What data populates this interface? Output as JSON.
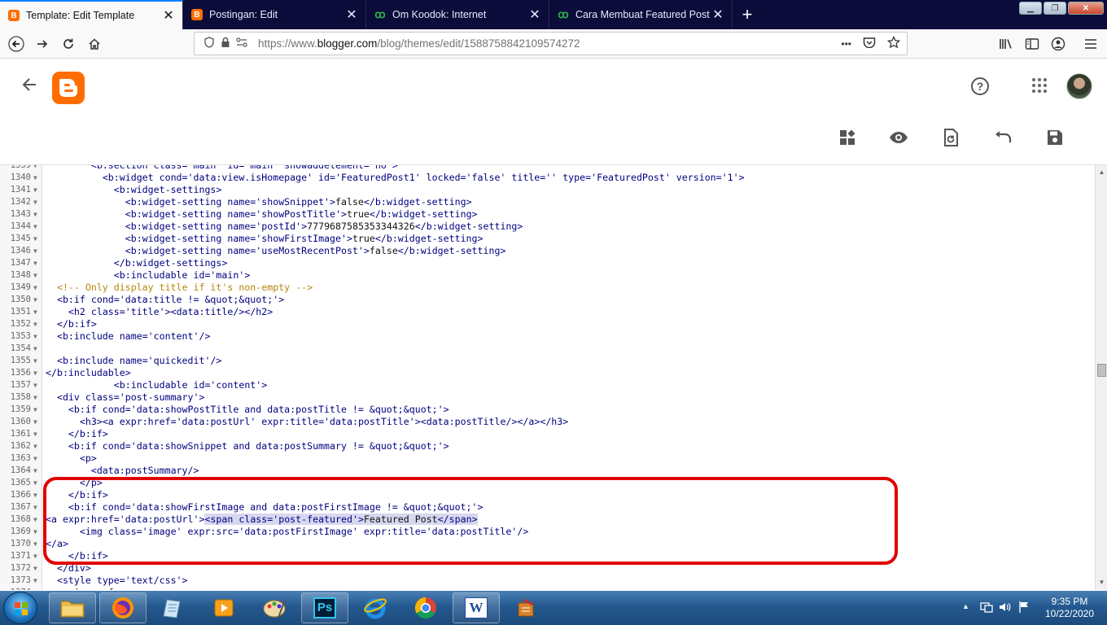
{
  "browser": {
    "tabs": [
      {
        "title": "Template: Edit Template",
        "icon": "blogger-icon",
        "active": true
      },
      {
        "title": "Postingan: Edit",
        "icon": "blogger-icon",
        "active": false
      },
      {
        "title": "Om Koodok: Internet",
        "icon": "koodok-icon",
        "active": false
      },
      {
        "title": "Cara Membuat Featured Post d",
        "icon": "koodok-icon",
        "active": false
      }
    ],
    "url_prefix": "https://www.",
    "url_domain": "blogger.com",
    "url_path": "/blog/themes/edit/1588758842109574272",
    "more_glyph": "•••"
  },
  "editor": {
    "lines": [
      {
        "n": "1339",
        "code": "        <b:section class='main' id='main' showaddelement='no'>"
      },
      {
        "n": "1340",
        "code": "          <b:widget cond='data:view.isHomepage' id='FeaturedPost1' locked='false' title='' type='FeaturedPost' version='1'>"
      },
      {
        "n": "1341",
        "code": "            <b:widget-settings>"
      },
      {
        "n": "1342",
        "code": "              <b:widget-setting name='showSnippet'>false</b:widget-setting>"
      },
      {
        "n": "1343",
        "code": "              <b:widget-setting name='showPostTitle'>true</b:widget-setting>"
      },
      {
        "n": "1344",
        "code": "              <b:widget-setting name='postId'>7779687585353344326</b:widget-setting>"
      },
      {
        "n": "1345",
        "code": "              <b:widget-setting name='showFirstImage'>true</b:widget-setting>"
      },
      {
        "n": "1346",
        "code": "              <b:widget-setting name='useMostRecentPost'>false</b:widget-setting>"
      },
      {
        "n": "1347",
        "code": "            </b:widget-settings>"
      },
      {
        "n": "1348",
        "code": "            <b:includable id='main'>"
      },
      {
        "n": "1349",
        "code": "  <!-- Only display title if it's non-empty -->"
      },
      {
        "n": "1350",
        "code": "  <b:if cond='data:title != &quot;&quot;'>"
      },
      {
        "n": "1351",
        "code": "    <h2 class='title'><data:title/></h2>"
      },
      {
        "n": "1352",
        "code": "  </b:if>"
      },
      {
        "n": "1353",
        "code": "  <b:include name='content'/>"
      },
      {
        "n": "1354",
        "code": ""
      },
      {
        "n": "1355",
        "code": "  <b:include name='quickedit'/>"
      },
      {
        "n": "1356",
        "code": "</b:includable>"
      },
      {
        "n": "1357",
        "code": "            <b:includable id='content'>"
      },
      {
        "n": "1358",
        "code": "  <div class='post-summary'>"
      },
      {
        "n": "1359",
        "code": "    <b:if cond='data:showPostTitle and data:postTitle != &quot;&quot;'>"
      },
      {
        "n": "1360",
        "code": "      <h3><a expr:href='data:postUrl' expr:title='data:postTitle'><data:postTitle/></a></h3>"
      },
      {
        "n": "1361",
        "code": "    </b:if>"
      },
      {
        "n": "1362",
        "code": "    <b:if cond='data:showSnippet and data:postSummary != &quot;&quot;'>"
      },
      {
        "n": "1363",
        "code": "      <p>"
      },
      {
        "n": "1364",
        "code": "        <data:postSummary/>"
      },
      {
        "n": "1365",
        "code": "      </p>"
      },
      {
        "n": "1366",
        "code": "    </b:if>"
      },
      {
        "n": "1367",
        "code": "    <b:if cond='data:showFirstImage and data:postFirstImage != &quot;&quot;'>"
      },
      {
        "n": "1368",
        "code": "<a expr:href='data:postUrl'>",
        "selected": "<span class='post-featured'>Featured Post</span>"
      },
      {
        "n": "1369",
        "code": "      <img class='image' expr:src='data:postFirstImage' expr:title='data:postTitle'/>"
      },
      {
        "n": "1370",
        "code": "</a>"
      },
      {
        "n": "1371",
        "code": "    </b:if>"
      },
      {
        "n": "1372",
        "code": "  </div>"
      },
      {
        "n": "1373",
        "code": "  <style type='text/css'>"
      },
      {
        "n": "1374",
        "code": "    .image {"
      }
    ]
  },
  "taskbar": {
    "time": "9:35 PM",
    "date": "10/22/2020",
    "apps": [
      "explorer",
      "firefox",
      "notepad",
      "media",
      "paint",
      "photoshop",
      "ie",
      "chrome",
      "word",
      "tool"
    ],
    "photoshop_label": "Ps",
    "word_label": "W"
  },
  "colors": {
    "accent": "#ff6d00",
    "highlight": "#e00000",
    "tab_bar": "#0c0c3a"
  }
}
